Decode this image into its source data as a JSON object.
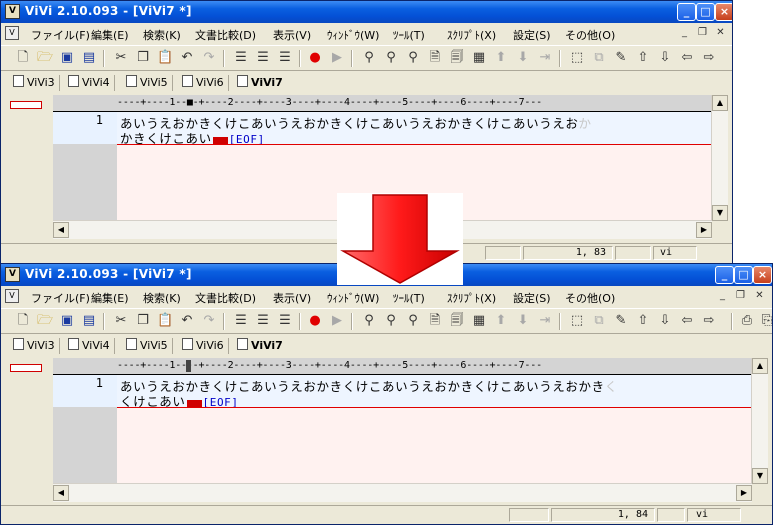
{
  "colors": {
    "title_blue": "#0450d6",
    "arrow_red": "#ff1a1a",
    "cursor_red": "#d00000",
    "eof_blue": "#0000c8",
    "text_bg": "#fff2f0"
  },
  "menu": [
    "ファイル(F)",
    "編集(E)",
    "検索(K)",
    "文書比較(D)",
    "表示(V)",
    "ｳｨﾝﾄﾞｳ(W)",
    "ﾂｰﾙ(T)",
    "ｽｸﾘﾌﾟﾄ(X)",
    "設定(S)",
    "その他(O)"
  ],
  "tabs": [
    "ViVi3",
    "ViVi4",
    "ViVi5",
    "ViVi6",
    "ViVi7"
  ],
  "eof": "[EOF]",
  "line_number": "1",
  "top": {
    "title": "ViVi 2.10.093 - [ViVi7 *]",
    "ruler": "----+----1--■-+----2----+----3----+----4----+----5----+----6----+----7---",
    "line1": "あいうえおかきくけこあいうえおかきくけこあいうえおかきくけこあいうえお",
    "line1_wrap": "か",
    "line2": "かきくけこあい",
    "status_pos": "1,  83",
    "status_mode": "vi"
  },
  "bottom": {
    "title": "ViVi 2.10.093 - [ViVi7 *]",
    "ruler": "----+----1----+----2----+----3----+----4----+----5----+----6----+----7---",
    "line1": "あいうえおかきくけこあいうえおかきくけこあいうえおかきくけこあいうえおかき",
    "line1_wrap": "く",
    "line2": "くけこあい",
    "status_pos": "1,  84",
    "status_mode": "vi"
  }
}
